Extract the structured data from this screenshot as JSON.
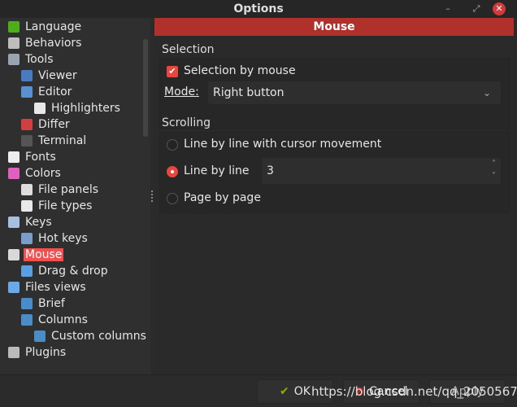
{
  "window": {
    "title": "Options",
    "minimize": "–",
    "maximize": "⤢",
    "close": "✕"
  },
  "tree": {
    "items": [
      {
        "label": "Language",
        "level": 0,
        "icon": "language-icon",
        "color": "#4caf1a"
      },
      {
        "label": "Behaviors",
        "level": 0,
        "icon": "lock-icon",
        "color": "#bdbdbd"
      },
      {
        "label": "Tools",
        "level": 0,
        "icon": "tools-icon",
        "color": "#9aa4b0"
      },
      {
        "label": "Viewer",
        "level": 1,
        "icon": "book-icon",
        "color": "#4a7bc0"
      },
      {
        "label": "Editor",
        "level": 1,
        "icon": "pencil-icon",
        "color": "#5a8fd0"
      },
      {
        "label": "Highlighters",
        "level": 2,
        "icon": "highlighter-icon",
        "color": "#e8e8e8"
      },
      {
        "label": "Differ",
        "level": 1,
        "icon": "differ-icon",
        "color": "#d04040"
      },
      {
        "label": "Terminal",
        "level": 1,
        "icon": "terminal-icon",
        "color": "#555555"
      },
      {
        "label": "Fonts",
        "level": 0,
        "icon": "font-icon",
        "color": "#eeeeee"
      },
      {
        "label": "Colors",
        "level": 0,
        "icon": "color-wheel-icon",
        "color": "#e060c0"
      },
      {
        "label": "File panels",
        "level": 1,
        "icon": "file-panels-icon",
        "color": "#dddddd"
      },
      {
        "label": "File types",
        "level": 1,
        "icon": "file-types-icon",
        "color": "#e8e8e8"
      },
      {
        "label": "Keys",
        "level": 0,
        "icon": "keyboard-icon",
        "color": "#a8c0e0"
      },
      {
        "label": "Hot keys",
        "level": 1,
        "icon": "hotkeys-icon",
        "color": "#7a9cc8"
      },
      {
        "label": "Mouse",
        "level": 0,
        "icon": "mouse-icon",
        "color": "#d8d8d8",
        "selected": true
      },
      {
        "label": "Drag & drop",
        "level": 1,
        "icon": "drag-drop-icon",
        "color": "#5aa0e0"
      },
      {
        "label": "Files views",
        "level": 0,
        "icon": "files-views-icon",
        "color": "#6aa8e8"
      },
      {
        "label": "Brief",
        "level": 1,
        "icon": "brief-icon",
        "color": "#4a8cc8"
      },
      {
        "label": "Columns",
        "level": 1,
        "icon": "columns-icon",
        "color": "#4a8cc8"
      },
      {
        "label": "Custom columns",
        "level": 2,
        "icon": "custom-columns-icon",
        "color": "#4a8cc8"
      },
      {
        "label": "Plugins",
        "level": 0,
        "icon": "plugins-icon",
        "color": "#bbbbbb"
      }
    ]
  },
  "page": {
    "header": "Mouse",
    "selection": {
      "title": "Selection",
      "checkbox_label": "Selection by mouse",
      "checked": true,
      "mode_label": "Mode:",
      "mode_value": "Right button"
    },
    "scrolling": {
      "title": "Scrolling",
      "options": [
        "Line by line with cursor movement",
        "Line by line",
        "Page by page"
      ],
      "selected": 1,
      "lines_value": "3"
    }
  },
  "buttons": {
    "ok": "OK",
    "cancel": "Cancel",
    "apply": "Apply"
  },
  "watermark": "https://blog.csdn.net/qq_20505673"
}
